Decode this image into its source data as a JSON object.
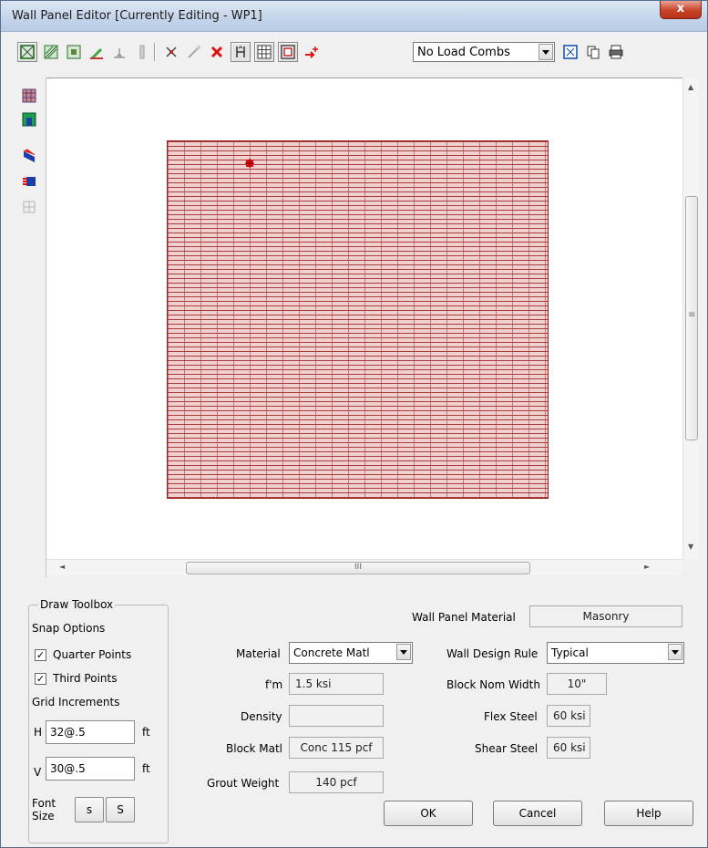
{
  "window": {
    "title": "Wall Panel Editor  [Currently Editing - WP1]",
    "close_label": "x"
  },
  "toolbar": {
    "load_combo": "No Load Combs"
  },
  "canvas": {
    "hscroll_grip": "III",
    "vscroll_grip": "≡"
  },
  "draw_toolbox": {
    "title": "Draw Toolbox",
    "snap_options_label": "Snap Options",
    "quarter_points_label": "Quarter Points",
    "quarter_points_checked": true,
    "third_points_label": "Third Points",
    "third_points_checked": true,
    "grid_increments_label": "Grid Increments",
    "h_label": "H",
    "h_value": "32@.5",
    "h_unit": "ft",
    "v_label": "V",
    "v_value": "30@.5",
    "v_unit": "ft",
    "font_size_label_1": "Font",
    "font_size_label_2": "Size",
    "font_small": "s",
    "font_large": "S"
  },
  "properties": {
    "wall_panel_material_label": "Wall Panel Material",
    "wall_panel_material_value": "Masonry",
    "material_label": "Material",
    "material_value": "Concrete Matl",
    "fm_label": "f'm",
    "fm_value": "1.5 ksi",
    "density_label": "Density",
    "density_value": "",
    "block_matl_label": "Block Matl",
    "block_matl_value": "Conc 115 pcf",
    "grout_weight_label": "Grout Weight",
    "grout_weight_value": "140 pcf",
    "wall_design_rule_label": "Wall Design Rule",
    "wall_design_rule_value": "Typical",
    "block_nom_width_label": "Block Nom Width",
    "block_nom_width_value": "10\"",
    "flex_steel_label": "Flex Steel",
    "flex_steel_value": "60 ksi",
    "shear_steel_label": "Shear Steel",
    "shear_steel_value": "60 ksi"
  },
  "buttons": {
    "ok": "OK",
    "cancel": "Cancel",
    "help": "Help"
  },
  "colors": {
    "wall_fill": "#f1d0d0",
    "wall_mortar": "#a63c3c",
    "wall_border": "#9b1e1e"
  }
}
